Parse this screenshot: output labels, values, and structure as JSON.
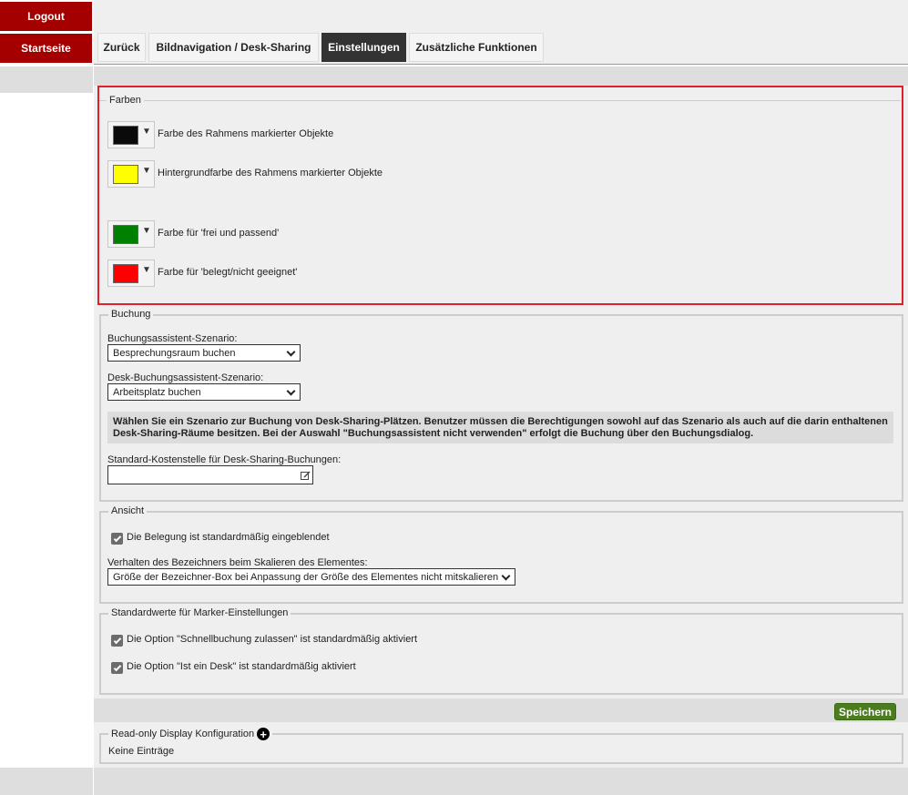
{
  "sidebar": {
    "logout_label": "Logout",
    "home_label": "Startseite"
  },
  "nav": {
    "tabs": [
      {
        "label": "Zurück"
      },
      {
        "label": "Bildnavigation / Desk-Sharing"
      },
      {
        "label": "Einstellungen",
        "active": true
      },
      {
        "label": "Zusätzliche Funktionen"
      }
    ]
  },
  "colors": {
    "legend": "Farben",
    "items": [
      {
        "label": "Farbe des Rahmens markierter Objekte",
        "color": "#0a0a0a"
      },
      {
        "label": "Hintergrundfarbe des Rahmens markierter Objekte",
        "color": "#ffff00"
      },
      {
        "label": "Farbe für 'frei und passend'",
        "color": "#008000"
      },
      {
        "label": "Farbe für 'belegt/nicht geeignet'",
        "color": "#ff0000"
      }
    ],
    "dropdown_glyph": "▼"
  },
  "booking": {
    "legend": "Buchung",
    "scenario_label": "Buchungsassistent-Szenario:",
    "scenario_value": "Besprechungsraum buchen",
    "desk_scenario_label": "Desk-Buchungsassistent-Szenario:",
    "desk_scenario_value": "Arbeitsplatz buchen",
    "info_text": "Wählen Sie ein Szenario zur Buchung von Desk-Sharing-Plätzen. Benutzer müssen die Berechtigungen sowohl auf das Szenario als auch auf die darin enthaltenen Desk-Sharing-Räume besitzen. Bei der Auswahl \"Buchungsassistent nicht verwenden\" erfolgt die Buchung über den Buchungsdialog.",
    "cost_center_label": "Standard-Kostenstelle für Desk-Sharing-Buchungen:",
    "cost_center_value": ""
  },
  "view": {
    "legend": "Ansicht",
    "occupancy_label": "Die Belegung ist standardmäßig eingeblendet",
    "occupancy_checked": true,
    "scaling_label": "Verhalten des Bezeichners beim Skalieren des Elementes:",
    "scaling_value": "Größe der Bezeichner-Box bei Anpassung der Größe des Elementes nicht mitskalieren"
  },
  "marker": {
    "legend": "Standardwerte für Marker-Einstellungen",
    "quick_booking_label": "Die Option \"Schnellbuchung zulassen\" ist standardmäßig aktiviert",
    "quick_booking_checked": true,
    "is_desk_label": "Die Option \"Ist ein Desk\" ist standardmäßig aktiviert",
    "is_desk_checked": true
  },
  "save_label": "Speichern",
  "readonly": {
    "legend": "Read-only Display Konfiguration",
    "empty_text": "Keine Einträge"
  },
  "accent": {
    "brand_red": "#a40000",
    "highlight_red": "#e0202a",
    "save_green": "#4b7d1f"
  }
}
